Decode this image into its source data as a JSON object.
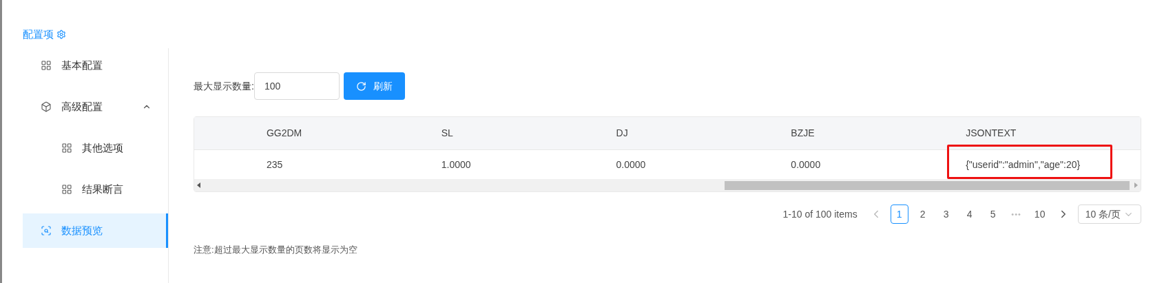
{
  "sidebar": {
    "title": "配置项",
    "items": [
      {
        "label": "基本配置",
        "kind": "grid",
        "selected": false
      },
      {
        "label": "高级配置",
        "kind": "cube",
        "selected": false,
        "expanded": true,
        "children": [
          {
            "label": "其他选项",
            "kind": "grid",
            "selected": false
          },
          {
            "label": "结果断言",
            "kind": "grid",
            "selected": false
          }
        ]
      },
      {
        "label": "数据预览",
        "kind": "preview",
        "selected": true
      }
    ]
  },
  "toolbar": {
    "label": "最大显示数量:",
    "max_field": {
      "value": "100"
    },
    "refresh_button": "刷新"
  },
  "table": {
    "columns": [
      "GG2DM",
      "SL",
      "DJ",
      "BZJE",
      "JSONTEXT"
    ],
    "rows": [
      {
        "cells": [
          {
            "text": "235",
            "highlighted": false
          },
          {
            "text": "1.0000",
            "highlighted": false
          },
          {
            "text": "0.0000",
            "highlighted": false
          },
          {
            "text": "0.0000",
            "highlighted": false
          },
          {
            "text": "{\"userid\":\"admin\",\"age\":20}",
            "highlighted": true
          }
        ]
      }
    ]
  },
  "pagination": {
    "summary": "1-10 of 100 items",
    "pages": [
      {
        "label": "1",
        "selected": true
      },
      {
        "label": "2",
        "selected": false
      },
      {
        "label": "3",
        "selected": false
      },
      {
        "label": "4",
        "selected": false
      },
      {
        "label": "5",
        "selected": false
      },
      {
        "label": "•••",
        "kind": "ellipsis"
      },
      {
        "label": "10",
        "selected": false
      }
    ],
    "page_size": "10 条/页"
  },
  "note": "注意:超过最大显示数量的页数将显示为空"
}
